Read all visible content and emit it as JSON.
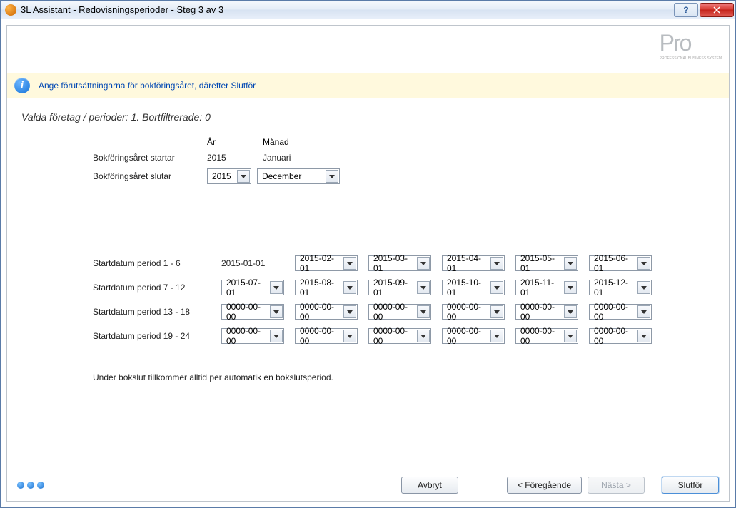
{
  "window": {
    "title": "3L Assistant - Redovisningsperioder - Steg 3 av 3"
  },
  "logo": {
    "text": "Pro",
    "sub": "PROFESSIONAL BUSINESS SYSTEM"
  },
  "info": {
    "message": "Ange förutsättningarna för bokföringsåret, därefter Slutför"
  },
  "summary": "Valda företag / perioder: 1. Bortfiltrerade: 0",
  "headers": {
    "year": "År",
    "month": "Månad"
  },
  "fy": {
    "start_label": "Bokföringsåret startar",
    "start_year": "2015",
    "start_month": "Januari",
    "end_label": "Bokföringsåret slutar",
    "end_year": "2015",
    "end_month": "December"
  },
  "periods": {
    "rows": [
      {
        "label": "Startdatum period 1 - 6",
        "first_static": "2015-01-01",
        "dates": [
          "2015-02-01",
          "2015-03-01",
          "2015-04-01",
          "2015-05-01",
          "2015-06-01"
        ]
      },
      {
        "label": "Startdatum period 7 - 12",
        "first_combo": "2015-07-01",
        "dates": [
          "2015-08-01",
          "2015-09-01",
          "2015-10-01",
          "2015-11-01",
          "2015-12-01"
        ]
      },
      {
        "label": "Startdatum period 13 - 18",
        "first_combo": "0000-00-00",
        "dates": [
          "0000-00-00",
          "0000-00-00",
          "0000-00-00",
          "0000-00-00",
          "0000-00-00"
        ]
      },
      {
        "label": "Startdatum period 19 - 24",
        "first_combo": "0000-00-00",
        "dates": [
          "0000-00-00",
          "0000-00-00",
          "0000-00-00",
          "0000-00-00",
          "0000-00-00"
        ]
      }
    ],
    "footnote": "Under bokslut tillkommer alltid per automatik en bokslutsperiod."
  },
  "buttons": {
    "cancel": "Avbryt",
    "prev": "< Föregående",
    "next": "Nästa >",
    "finish": "Slutför"
  }
}
